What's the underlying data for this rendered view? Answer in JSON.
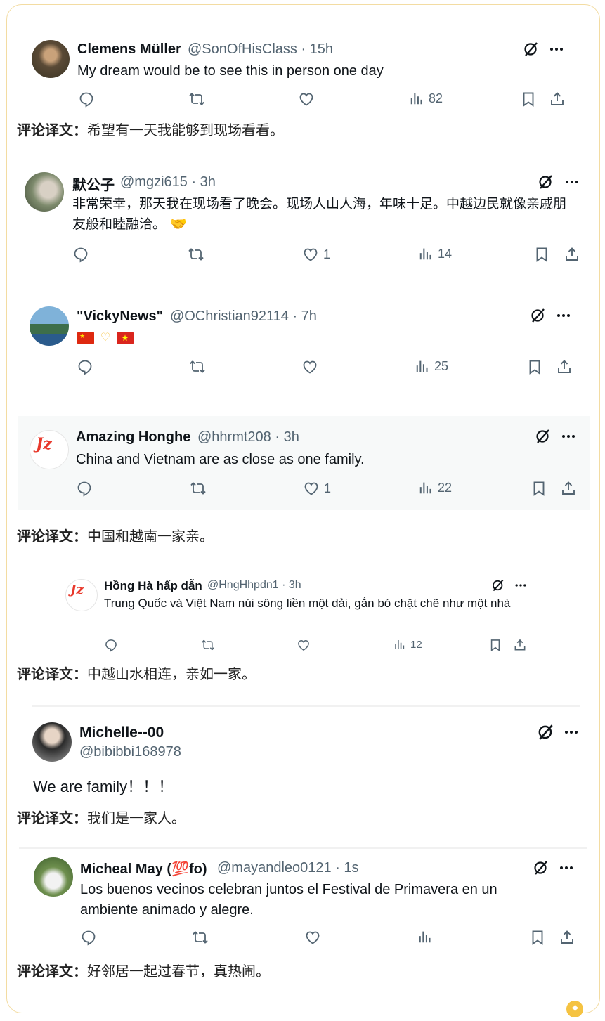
{
  "caption_label": "评论译文：",
  "tweets": [
    {
      "name": "Clemens Müller",
      "handle": "@SonOfHisClass · 15h",
      "text": "My dream would be to see this in person one day",
      "likes": "",
      "views": "82",
      "caption": "希望有一天我能够到现场看看。"
    },
    {
      "name": "默公子",
      "handle": "@mgzi615 · 3h",
      "text": "非常荣幸，那天我在现场看了晚会。现场人山人海，年味十足。中越边民就像亲戚朋友般和睦融洽。",
      "emoji": "🤝",
      "likes": "1",
      "views": "14"
    },
    {
      "name": "\"VickyNews\"",
      "handle": "@OChristian92114 · 7h",
      "text": "",
      "likes": "",
      "views": "25"
    },
    {
      "name": "Amazing Honghe",
      "handle": "@hhrmt208 · 3h",
      "text": "China and Vietnam are as close as one family.",
      "likes": "1",
      "views": "22",
      "caption": "中国和越南一家亲。"
    },
    {
      "name": "Hồng Hà hấp dẫn",
      "handle": "@HngHhpdn1 · 3h",
      "text": "Trung Quốc và Việt Nam núi sông liền một dải, gắn bó chặt chẽ như một nhà",
      "likes": "",
      "views": "12",
      "caption": "中越山水相连，亲如一家。"
    },
    {
      "name": "Michelle--00",
      "handle": "@bibibbi168978",
      "text": "We are family！！！",
      "caption": "我们是一家人。"
    },
    {
      "name": "Micheal May (💯fo)",
      "handle": "@mayandleo0121 · 1s",
      "text": "Los buenos vecinos celebran juntos el Festival de Primavera en un ambiente animado y alegre.",
      "likes": "",
      "views": "",
      "caption": "好邻居一起过春节，真热闹。"
    }
  ],
  "colors": {
    "accent": "#f5c342",
    "icon": "#536471",
    "border": "#f3dca2"
  }
}
